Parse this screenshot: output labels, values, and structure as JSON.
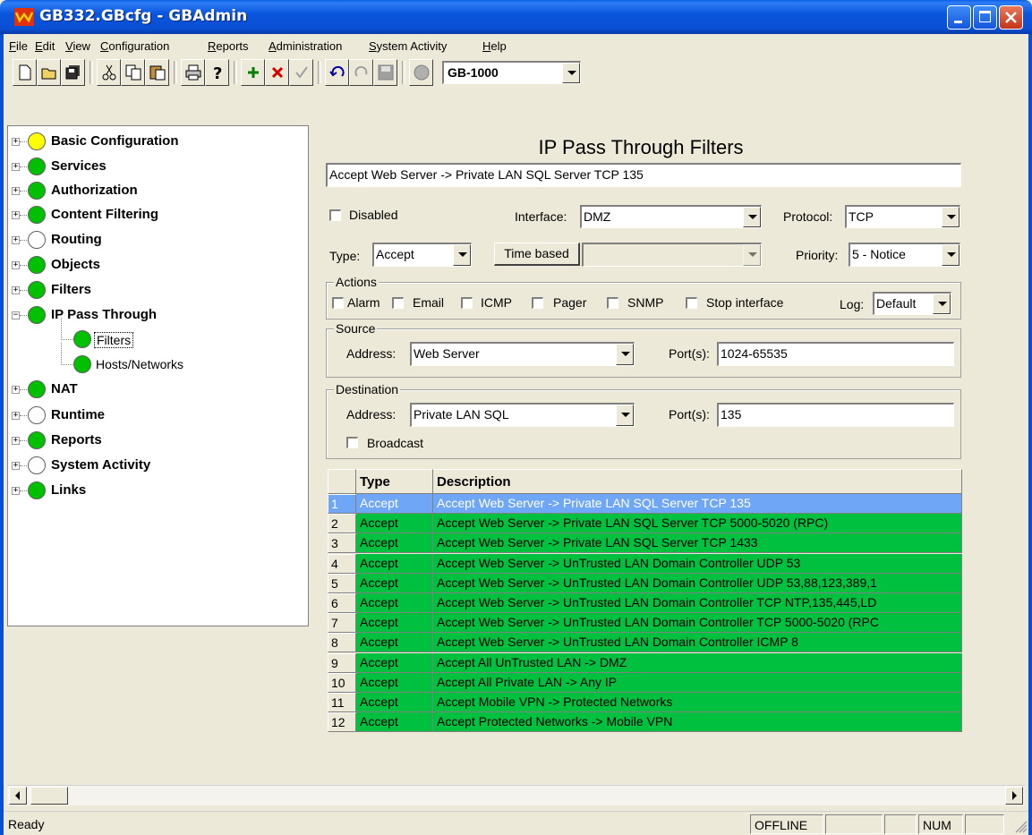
{
  "window": {
    "title": "GB332.GBcfg - GBAdmin"
  },
  "menu": [
    {
      "label": "File",
      "u": "F",
      "rest": "ile"
    },
    {
      "label": "Edit",
      "u": "E",
      "rest": "dit"
    },
    {
      "label": "View",
      "u": "V",
      "rest": "iew"
    },
    {
      "label": "Configuration",
      "u": "C",
      "rest": "onfiguration"
    },
    {
      "label": "Reports",
      "u": "R",
      "rest": "eports"
    },
    {
      "label": "Administration",
      "u": "A",
      "rest": "dministration"
    },
    {
      "label": "System Activity",
      "u": "S",
      "rest": "ystem Activity"
    },
    {
      "label": "Help",
      "u": "H",
      "rest": "elp"
    }
  ],
  "toolbar": {
    "device": "GB-1000"
  },
  "tree": [
    {
      "label": "Basic Configuration",
      "status": "yellow",
      "expander": "+"
    },
    {
      "label": "Services",
      "status": "green",
      "expander": "+"
    },
    {
      "label": "Authorization",
      "status": "green",
      "expander": "+"
    },
    {
      "label": "Content Filtering",
      "status": "green",
      "expander": "+"
    },
    {
      "label": "Routing",
      "status": "white",
      "expander": "+"
    },
    {
      "label": "Objects",
      "status": "green",
      "expander": "+"
    },
    {
      "label": "Filters",
      "status": "green",
      "expander": "+"
    },
    {
      "label": "IP Pass Through",
      "status": "green",
      "expander": "-"
    },
    {
      "label": "Filters",
      "status": "green",
      "child": true
    },
    {
      "label": "Hosts/Networks",
      "status": "green",
      "child": true
    },
    {
      "label": "NAT",
      "status": "green",
      "expander": "+"
    },
    {
      "label": "Runtime",
      "status": "white",
      "expander": "+"
    },
    {
      "label": "Reports",
      "status": "green",
      "expander": "+"
    },
    {
      "label": "System Activity",
      "status": "white",
      "expander": "+"
    },
    {
      "label": "Links",
      "status": "green",
      "expander": "+"
    }
  ],
  "status_colors": {
    "green": "#00c000",
    "yellow": "#ffff00",
    "white": "#ffffff"
  },
  "form": {
    "title": "IP Pass Through Filters",
    "description": "Accept Web Server -> Private LAN SQL Server TCP 135",
    "disabled_label": "Disabled",
    "interface_label": "Interface:",
    "interface_value": "DMZ",
    "protocol_label": "Protocol:",
    "protocol_value": "TCP",
    "type_label": "Type:",
    "type_value": "Accept",
    "time_based_label": "Time based",
    "priority_label": "Priority:",
    "priority_value": "5 - Notice",
    "actions_label": "Actions",
    "actions": [
      "Alarm",
      "Email",
      "ICMP",
      "Pager",
      "SNMP",
      "Stop interface"
    ],
    "log_label": "Log:",
    "log_value": "Default",
    "source_label": "Source",
    "source_address_label": "Address:",
    "source_address": "Web Server",
    "source_ports_label": "Port(s):",
    "source_ports": "1024-65535",
    "dest_label": "Destination",
    "dest_address_label": "Address:",
    "dest_address": "Private LAN SQL",
    "dest_ports_label": "Port(s):",
    "dest_ports": "135",
    "broadcast_label": "Broadcast"
  },
  "grid": {
    "headers": {
      "type": "Type",
      "description": "Description"
    },
    "rows": [
      {
        "n": "1",
        "type": "Accept",
        "description": "Accept Web Server -> Private LAN SQL Server TCP 135"
      },
      {
        "n": "2",
        "type": "Accept",
        "description": "Accept Web Server -> Private LAN SQL Server TCP 5000-5020 (RPC)"
      },
      {
        "n": "3",
        "type": "Accept",
        "description": "Accept Web Server -> Private LAN SQL Server TCP 1433"
      },
      {
        "n": "4",
        "type": "Accept",
        "description": "Accept Web Server -> UnTrusted LAN Domain Controller UDP 53"
      },
      {
        "n": "5",
        "type": "Accept",
        "description": "Accept Web Server -> UnTrusted LAN Domain Controller UDP 53,88,123,389,1"
      },
      {
        "n": "6",
        "type": "Accept",
        "description": "Accept Web Server -> UnTrusted LAN Domain Controller TCP NTP,135,445,LD"
      },
      {
        "n": "7",
        "type": "Accept",
        "description": "Accept Web Server -> UnTrusted LAN Domain Controller TCP 5000-5020 (RPC"
      },
      {
        "n": "8",
        "type": "Accept",
        "description": "Accept Web Server -> UnTrusted LAN Domain Controller ICMP 8"
      },
      {
        "n": "9",
        "type": "Accept",
        "description": "Accept All UnTrusted LAN -> DMZ"
      },
      {
        "n": "10",
        "type": "Accept",
        "description": "Accept All Private LAN -> Any IP"
      },
      {
        "n": "11",
        "type": "Accept",
        "description": "Accept Mobile VPN -> Protected Networks"
      },
      {
        "n": "12",
        "type": "Accept",
        "description": "Accept Protected Networks -> Mobile VPN"
      }
    ]
  },
  "statusbar": {
    "text": "Ready",
    "offline": "OFFLINE",
    "num": "NUM"
  }
}
